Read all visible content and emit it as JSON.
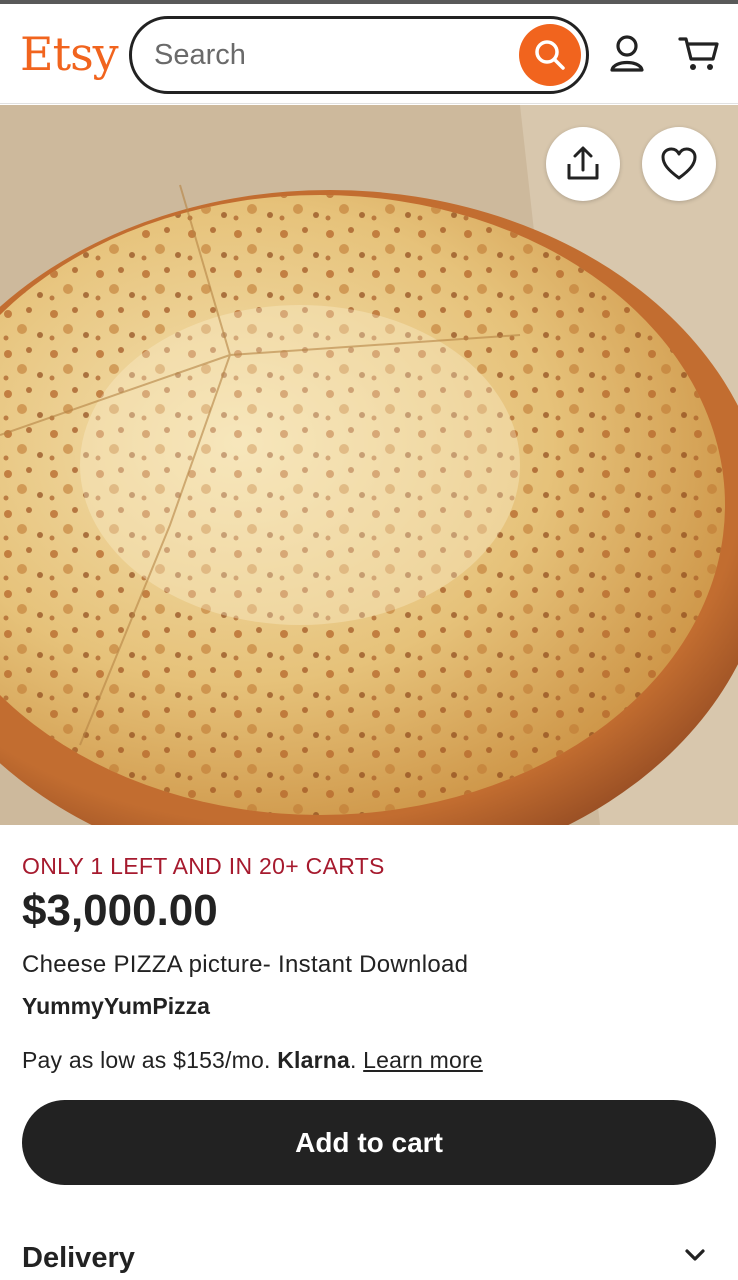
{
  "header": {
    "logo": "Etsy",
    "search_placeholder": "Search",
    "icons": [
      "search-icon",
      "account-icon",
      "cart-icon"
    ]
  },
  "listing": {
    "image_subject": "cheese pizza",
    "actions": [
      "share-icon",
      "heart-icon"
    ],
    "stock_notice": "ONLY 1 LEFT AND IN 20+ CARTS",
    "price": "$3,000.00",
    "title": "Cheese PIZZA picture- Instant Download",
    "shop_name": "YummyYumPizza",
    "klarna": {
      "prefix": "Pay as low as $153/mo.",
      "brand": "Klarna",
      "suffix": ".",
      "link": "Learn more"
    },
    "add_to_cart": "Add to cart",
    "delivery_label": "Delivery"
  },
  "colors": {
    "brand": "#f1641e",
    "stock_notice": "#a61a2e",
    "button": "#222222"
  }
}
